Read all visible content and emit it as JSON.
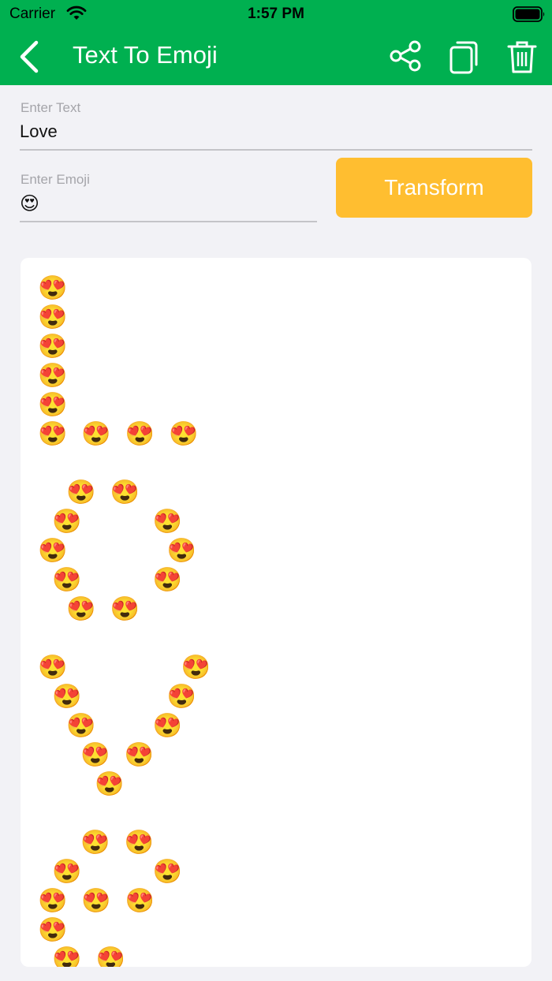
{
  "status_bar": {
    "carrier": "Carrier",
    "time": "1:57 PM"
  },
  "nav": {
    "title": "Text To Emoji",
    "icons": [
      "chevron-left-icon",
      "share-icon",
      "copy-icon",
      "trash-icon"
    ]
  },
  "form": {
    "text_label": "Enter Text",
    "text_value": "Love",
    "emoji_label": "Enter Emoji",
    "emoji_value": "😍",
    "transform_label": "Transform"
  },
  "output": {
    "art": "😍\n😍\n😍\n😍\n😍\n😍 😍 😍 😍\n\n  😍 😍\n 😍     😍\n😍       😍\n 😍     😍\n  😍 😍\n\n😍        😍\n 😍      😍\n  😍    😍\n   😍 😍\n    😍\n\n   😍 😍\n 😍     😍\n😍 😍 😍\n😍\n 😍 😍"
  },
  "colors": {
    "accent_green": "#00b050",
    "button_yellow": "#ffbe30",
    "background": "#f2f2f6",
    "card": "#ffffff"
  }
}
